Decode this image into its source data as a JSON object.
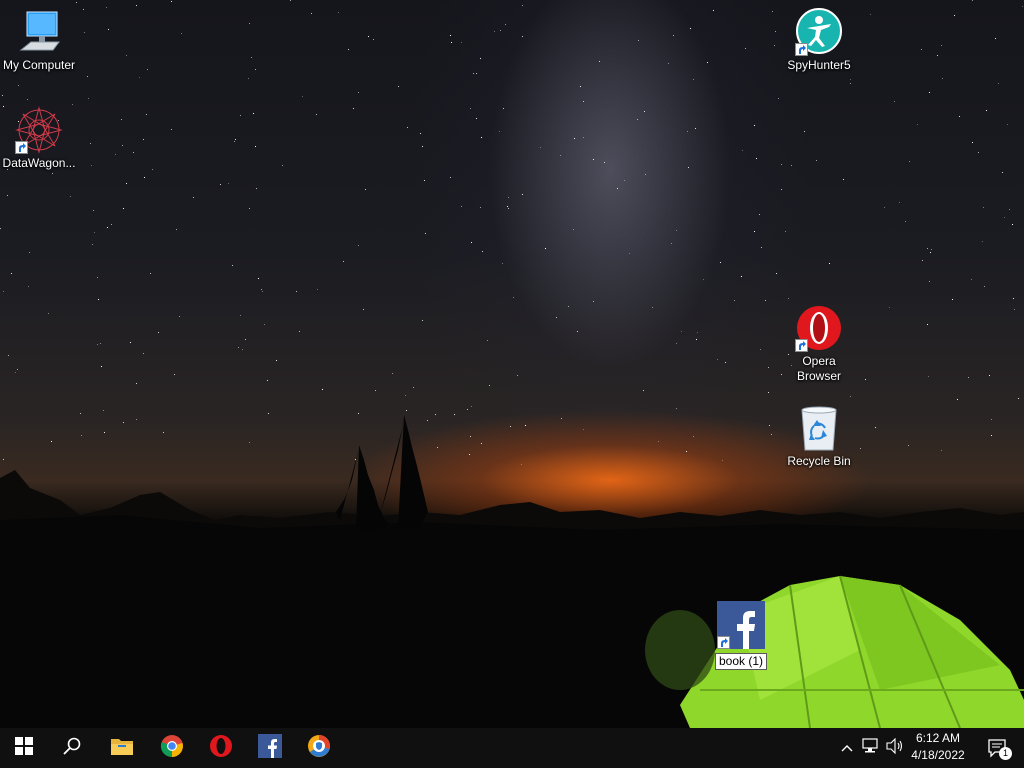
{
  "desktop": {
    "icons": [
      {
        "label": "My Computer"
      },
      {
        "label": "DataWagon..."
      },
      {
        "label": "SpyHunter5"
      },
      {
        "label": "Opera Browser"
      },
      {
        "label": "Recycle Bin"
      },
      {
        "label": "book (1)"
      }
    ]
  },
  "taskbar": {
    "pinned": [
      "start-icon",
      "search-icon",
      "file-explorer-icon",
      "chrome-icon",
      "opera-icon",
      "facebook-icon",
      "browser-shield-icon"
    ],
    "tray": {
      "time": "6:12 AM",
      "date": "4/18/2022",
      "notification_count": "1"
    }
  },
  "colors": {
    "taskbar": "#101010",
    "start_blue": "#ffffff",
    "facebook": "#3b5998",
    "opera": "#e0181e",
    "tent": "#8fd82b",
    "horizon_glow": "#ff6e14"
  }
}
